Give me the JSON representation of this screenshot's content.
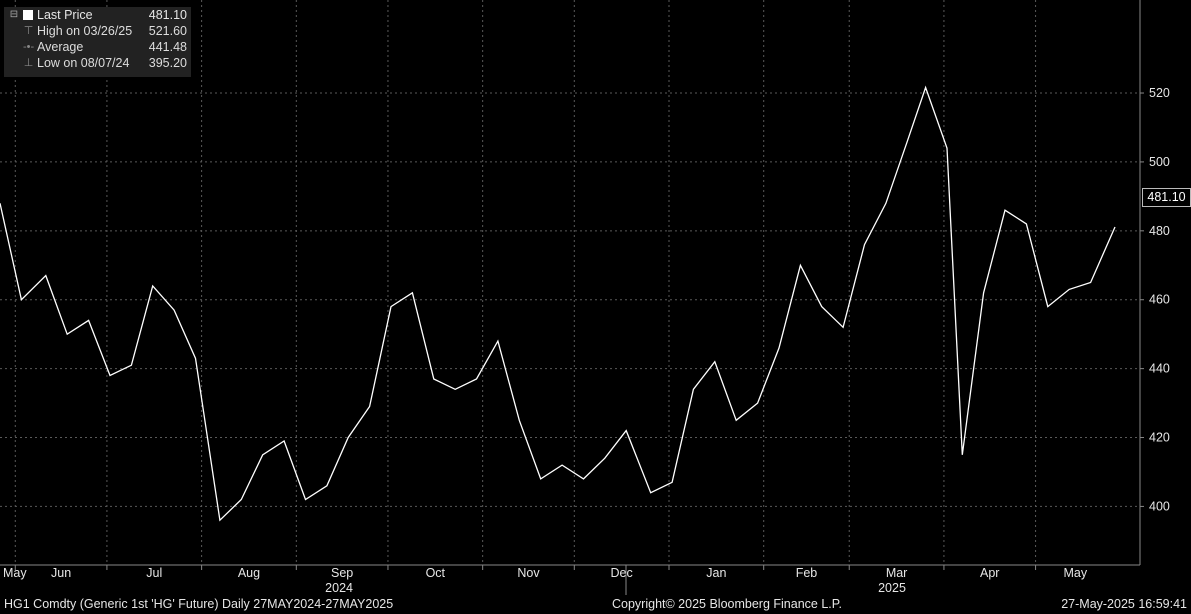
{
  "legend": {
    "last_label": "Last Price",
    "last_value": "481.10",
    "high_label": "High on 03/26/25",
    "high_value": "521.60",
    "avg_label": "Average",
    "avg_value": "441.48",
    "low_label": "Low on 08/07/24",
    "low_value": "395.20"
  },
  "price_tag": "481.10",
  "footer": {
    "left": "HG1 Comdty (Generic 1st 'HG' Future)  Daily 27MAY2024-27MAY2025",
    "center": "Copyright© 2025 Bloomberg Finance L.P.",
    "right": "27-May-2025 16:59:41"
  },
  "colors": {
    "background": "#000000",
    "line": "#ffffff",
    "grid": "#5a5a5a",
    "legend_bg": "#222222"
  },
  "chart_data": {
    "type": "line",
    "title": "",
    "xlabel": "",
    "ylabel": "",
    "ylim": [
      383,
      547
    ],
    "yticks": [
      "400",
      "420",
      "440",
      "460",
      "480",
      "500",
      "520"
    ],
    "x_range": [
      "2024-05-27",
      "2025-05-27"
    ],
    "month_labels": [
      "May",
      "Jun",
      "Jul",
      "Aug",
      "Sep",
      "Oct",
      "Nov",
      "Dec",
      "Jan",
      "Feb",
      "Mar",
      "Apr",
      "May"
    ],
    "year_labels": [
      "2024",
      "2025"
    ],
    "grid": true,
    "legend_position": "top-left",
    "series": [
      {
        "name": "Last Price",
        "x": [
          "2024-05-27",
          "2024-06-03",
          "2024-06-11",
          "2024-06-18",
          "2024-06-25",
          "2024-07-02",
          "2024-07-09",
          "2024-07-16",
          "2024-07-23",
          "2024-07-30",
          "2024-08-07",
          "2024-08-14",
          "2024-08-21",
          "2024-08-28",
          "2024-09-04",
          "2024-09-11",
          "2024-09-18",
          "2024-09-25",
          "2024-10-02",
          "2024-10-09",
          "2024-10-16",
          "2024-10-23",
          "2024-10-30",
          "2024-11-06",
          "2024-11-13",
          "2024-11-20",
          "2024-11-27",
          "2024-12-04",
          "2024-12-11",
          "2024-12-18",
          "2024-12-26",
          "2025-01-02",
          "2025-01-09",
          "2025-01-16",
          "2025-01-23",
          "2025-01-30",
          "2025-02-06",
          "2025-02-13",
          "2025-02-20",
          "2025-02-27",
          "2025-03-06",
          "2025-03-13",
          "2025-03-20",
          "2025-03-26",
          "2025-04-02",
          "2025-04-07",
          "2025-04-14",
          "2025-04-21",
          "2025-04-28",
          "2025-05-05",
          "2025-05-12",
          "2025-05-19",
          "2025-05-27"
        ],
        "values": [
          488,
          460,
          467,
          450,
          454,
          438,
          441,
          464,
          457,
          443,
          396,
          402,
          415,
          419,
          402,
          406,
          420,
          429,
          458,
          462,
          437,
          434,
          437,
          448,
          425,
          408,
          412,
          408,
          414,
          422,
          404,
          407,
          434,
          442,
          425,
          430,
          446,
          470,
          458,
          452,
          476,
          488,
          506,
          521.6,
          504,
          415,
          462,
          486,
          482,
          458,
          463,
          465,
          481.1
        ]
      }
    ]
  }
}
